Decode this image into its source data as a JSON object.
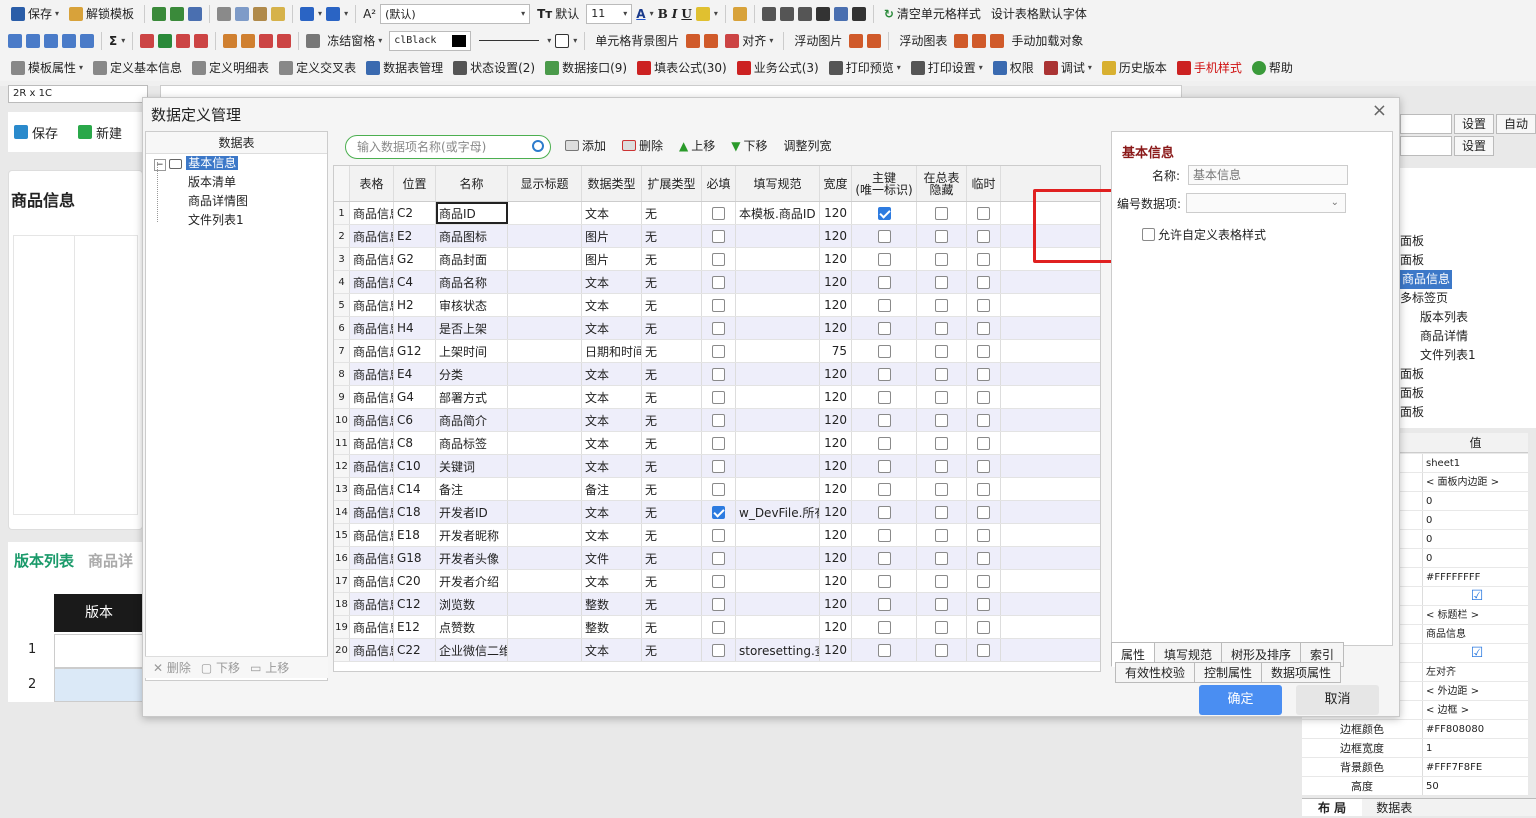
{
  "toolbar1": {
    "save": "保存",
    "unlock_template": "解锁模板",
    "font_family": "(默认)",
    "default_label": "默认",
    "font_size": "11",
    "bold": "B",
    "italic": "I",
    "underline": "U",
    "clear_cell_style": "清空单元格样式",
    "set_default_font": "设计表格默认字体"
  },
  "toolbar2": {
    "sigma": "Σ",
    "freeze": "冻结窗格",
    "color_value": "clBlack",
    "cell_bg_image": "单元格背景图片",
    "align": "对齐",
    "float_image": "浮动图片",
    "float_chart": "浮动图表",
    "manual_load": "手动加载对象"
  },
  "toolbar3": {
    "items": [
      "模板属性",
      "定义基本信息",
      "定义明细表",
      "定义交叉表",
      "数据表管理",
      "状态设置(2)",
      "数据接口(9)",
      "填表公式(30)",
      "业务公式(3)",
      "打印预览",
      "打印设置",
      "权限",
      "调试",
      "历史版本",
      "手机样式",
      "帮助"
    ]
  },
  "namebox": "2R x 1C",
  "leftpane": {
    "save": "保存",
    "new": "新建",
    "title": "商品信息",
    "tab_active": "版本列表",
    "tab_other": "商品详",
    "col_header": "版本",
    "row1": "1",
    "row2": "2"
  },
  "dialog": {
    "title": "数据定义管理",
    "close": "×",
    "tree": {
      "header": "数据表",
      "root": "基本信息",
      "children": [
        "版本清单",
        "商品详情图",
        "文件列表1"
      ],
      "footer": [
        "删除",
        "下移",
        "上移"
      ]
    },
    "search_placeholder": "输入数据项名称(或字母)",
    "actions": [
      "添加",
      "删除",
      "上移",
      "下移",
      "调整列宽"
    ],
    "columns": [
      "表格",
      "位置",
      "名称",
      "显示标题",
      "数据类型",
      "扩展类型",
      "必填",
      "填写规范",
      "宽度",
      "主键\n(唯一标识)",
      "在总表\n隐藏",
      "临时"
    ],
    "rows": [
      {
        "n": "1",
        "t": "商品信息",
        "p": "C2",
        "name": "商品ID",
        "title": "",
        "type": "文本",
        "ext": "无",
        "req": false,
        "spec": "本模板.商品ID",
        "w": "120",
        "pk": true,
        "hide": false,
        "tmp": false
      },
      {
        "n": "2",
        "t": "商品信息",
        "p": "E2",
        "name": "商品图标",
        "title": "",
        "type": "图片",
        "ext": "无",
        "req": false,
        "spec": "",
        "w": "120",
        "pk": false,
        "hide": false,
        "tmp": false
      },
      {
        "n": "3",
        "t": "商品信息",
        "p": "G2",
        "name": "商品封面",
        "title": "",
        "type": "图片",
        "ext": "无",
        "req": false,
        "spec": "",
        "w": "120",
        "pk": false,
        "hide": false,
        "tmp": false
      },
      {
        "n": "4",
        "t": "商品信息",
        "p": "C4",
        "name": "商品名称",
        "title": "",
        "type": "文本",
        "ext": "无",
        "req": false,
        "spec": "",
        "w": "120",
        "pk": false,
        "hide": false,
        "tmp": false
      },
      {
        "n": "5",
        "t": "商品信息",
        "p": "H2",
        "name": "审核状态",
        "title": "",
        "type": "文本",
        "ext": "无",
        "req": false,
        "spec": "",
        "w": "120",
        "pk": false,
        "hide": false,
        "tmp": false
      },
      {
        "n": "6",
        "t": "商品信息",
        "p": "H4",
        "name": "是否上架",
        "title": "",
        "type": "文本",
        "ext": "无",
        "req": false,
        "spec": "",
        "w": "120",
        "pk": false,
        "hide": false,
        "tmp": false
      },
      {
        "n": "7",
        "t": "商品信息",
        "p": "G12",
        "name": "上架时间",
        "title": "",
        "type": "日期和时间",
        "ext": "无",
        "req": false,
        "spec": "",
        "w": "75",
        "pk": false,
        "hide": false,
        "tmp": false
      },
      {
        "n": "8",
        "t": "商品信息",
        "p": "E4",
        "name": "分类",
        "title": "",
        "type": "文本",
        "ext": "无",
        "req": false,
        "spec": "",
        "w": "120",
        "pk": false,
        "hide": false,
        "tmp": false
      },
      {
        "n": "9",
        "t": "商品信息",
        "p": "G4",
        "name": "部署方式",
        "title": "",
        "type": "文本",
        "ext": "无",
        "req": false,
        "spec": "",
        "w": "120",
        "pk": false,
        "hide": false,
        "tmp": false
      },
      {
        "n": "10",
        "t": "商品信息",
        "p": "C6",
        "name": "商品简介",
        "title": "",
        "type": "文本",
        "ext": "无",
        "req": false,
        "spec": "",
        "w": "120",
        "pk": false,
        "hide": false,
        "tmp": false
      },
      {
        "n": "11",
        "t": "商品信息",
        "p": "C8",
        "name": "商品标签",
        "title": "",
        "type": "文本",
        "ext": "无",
        "req": false,
        "spec": "",
        "w": "120",
        "pk": false,
        "hide": false,
        "tmp": false
      },
      {
        "n": "12",
        "t": "商品信息",
        "p": "C10",
        "name": "关键词",
        "title": "",
        "type": "文本",
        "ext": "无",
        "req": false,
        "spec": "",
        "w": "120",
        "pk": false,
        "hide": false,
        "tmp": false
      },
      {
        "n": "13",
        "t": "商品信息",
        "p": "C14",
        "name": "备注",
        "title": "",
        "type": "备注",
        "ext": "无",
        "req": false,
        "spec": "",
        "w": "120",
        "pk": false,
        "hide": false,
        "tmp": false
      },
      {
        "n": "14",
        "t": "商品信息",
        "p": "C18",
        "name": "开发者ID",
        "title": "",
        "type": "文本",
        "ext": "无",
        "req": true,
        "spec": "w_DevFile.所有:",
        "w": "120",
        "pk": false,
        "hide": false,
        "tmp": false
      },
      {
        "n": "15",
        "t": "商品信息",
        "p": "E18",
        "name": "开发者昵称",
        "title": "",
        "type": "文本",
        "ext": "无",
        "req": false,
        "spec": "",
        "w": "120",
        "pk": false,
        "hide": false,
        "tmp": false
      },
      {
        "n": "16",
        "t": "商品信息",
        "p": "G18",
        "name": "开发者头像",
        "title": "",
        "type": "文件",
        "ext": "无",
        "req": false,
        "spec": "",
        "w": "120",
        "pk": false,
        "hide": false,
        "tmp": false
      },
      {
        "n": "17",
        "t": "商品信息",
        "p": "C20",
        "name": "开发者介绍",
        "title": "",
        "type": "文本",
        "ext": "无",
        "req": false,
        "spec": "",
        "w": "120",
        "pk": false,
        "hide": false,
        "tmp": false
      },
      {
        "n": "18",
        "t": "商品信息",
        "p": "C12",
        "name": "浏览数",
        "title": "",
        "type": "整数",
        "ext": "无",
        "req": false,
        "spec": "",
        "w": "120",
        "pk": false,
        "hide": false,
        "tmp": false
      },
      {
        "n": "19",
        "t": "商品信息",
        "p": "E12",
        "name": "点赞数",
        "title": "",
        "type": "整数",
        "ext": "无",
        "req": false,
        "spec": "",
        "w": "120",
        "pk": false,
        "hide": false,
        "tmp": false
      },
      {
        "n": "20",
        "t": "商品信息",
        "p": "C22",
        "name": "企业微信二维",
        "title": "",
        "type": "文本",
        "ext": "无",
        "req": false,
        "spec": "storesetting.查询",
        "w": "120",
        "pk": false,
        "hide": false,
        "tmp": false
      }
    ],
    "info": {
      "title": "基本信息",
      "name_label": "名称:",
      "name_value": "基本信息",
      "code_label": "编号数据项:",
      "allow_custom": "允许自定义表格样式"
    },
    "tabs1": [
      "属性",
      "填写规范",
      "树形及排序",
      "索引"
    ],
    "tabs2": [
      "有效性校验",
      "控制属性",
      "数据项属性"
    ],
    "ok": "确定",
    "cancel": "取消"
  },
  "rightpanel": {
    "btn_set": "设置",
    "btn_auto": "自动",
    "btn_set2": "设置",
    "tree_items": [
      "面板",
      "面板",
      "商品信息",
      "多标签页",
      "版本列表",
      "商品详情",
      "文件列表1",
      "面板",
      "面板",
      "面板"
    ],
    "val_header": "值",
    "props": [
      {
        "k": "",
        "v": "sheet1"
      },
      {
        "k": "",
        "v": "< 面板内边距 >"
      },
      {
        "k": "",
        "v": "0"
      },
      {
        "k": "",
        "v": "0"
      },
      {
        "k": "",
        "v": "0"
      },
      {
        "k": "",
        "v": "0"
      },
      {
        "k": "",
        "v": "#FFFFFFFF"
      },
      {
        "k": "",
        "v": "☑"
      },
      {
        "k": "",
        "v": "< 标题栏 >"
      },
      {
        "k": "",
        "v": "商品信息"
      },
      {
        "k": "",
        "v": "☑"
      },
      {
        "k": "",
        "v": "左对齐"
      },
      {
        "k": "",
        "v": "< 外边距 >"
      },
      {
        "k": "",
        "v": "< 边框 >"
      },
      {
        "k": "边框颜色",
        "v": "#FF808080"
      },
      {
        "k": "边框宽度",
        "v": "1"
      },
      {
        "k": "背景颜色",
        "v": "#FFF7F8FE"
      },
      {
        "k": "高度",
        "v": "50"
      }
    ],
    "bottom_tabs": [
      "布 局",
      "数据表"
    ]
  }
}
